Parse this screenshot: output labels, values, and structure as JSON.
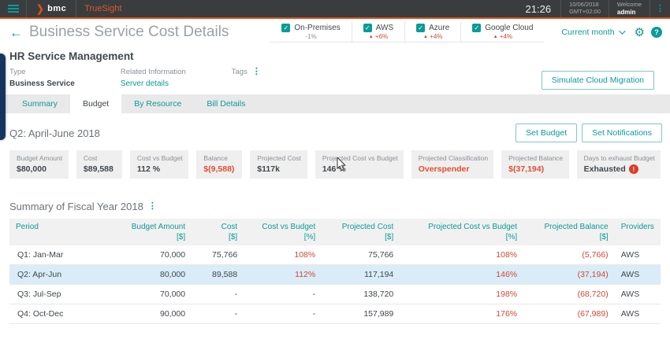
{
  "colors": {
    "accent_teal": "#0a9b98",
    "brand_orange": "#dd4f13",
    "negative_red": "#d14836",
    "row_highlight": "#d9ecf7"
  },
  "topbar": {
    "logo": "bmc",
    "product": "TrueSight",
    "time": "21:26",
    "date": "10/06/2018",
    "timezone": "GMT+02:00",
    "welcome_label": "Welcome",
    "user": "admin"
  },
  "header": {
    "title": "Business Service Cost Details",
    "providers": [
      {
        "label": "On-Premises",
        "delta": "-1%",
        "trend": "none"
      },
      {
        "label": "AWS",
        "delta": "+6%",
        "trend": "up"
      },
      {
        "label": "Azure",
        "delta": "+4%",
        "trend": "up"
      },
      {
        "label": "Google Cloud",
        "delta": "+4%",
        "trend": "up"
      }
    ],
    "period_selector": "Current month",
    "help_label": "?"
  },
  "service": {
    "name": "HR Service Management",
    "type_label": "Type",
    "type_value": "Business Service",
    "related_label": "Related Information",
    "related_link": "Server details",
    "tags_label": "Tags",
    "simulate_button": "Simulate Cloud Migration"
  },
  "tabs": [
    {
      "label": "Summary",
      "active": false
    },
    {
      "label": "Budget",
      "active": true
    },
    {
      "label": "By Resource",
      "active": false
    },
    {
      "label": "Bill Details",
      "active": false
    }
  ],
  "budget_section": {
    "quarter_title": "Q2: April-June 2018",
    "set_budget_button": "Set Budget",
    "set_notifications_button": "Set Notifications",
    "kpis": [
      {
        "label": "Budget Amount",
        "value": "$80,000",
        "tone": "normal"
      },
      {
        "label": "Cost",
        "value": "$89,588",
        "tone": "normal"
      },
      {
        "label": "Cost vs Budget",
        "value": "112 %",
        "tone": "normal"
      },
      {
        "label": "Balance",
        "value": "$(9,588)",
        "tone": "negative"
      },
      {
        "label": "Projected Cost",
        "value": "$117k",
        "tone": "normal"
      },
      {
        "label": "Projected Cost vs Budget",
        "value": "146 %",
        "tone": "normal"
      },
      {
        "label": "Projected Classification",
        "value": "Overspender",
        "tone": "negative"
      },
      {
        "label": "Projected Balance",
        "value": "$(37,194)",
        "tone": "negative"
      },
      {
        "label": "Days to exhaust Budget",
        "value": "Exhausted",
        "tone": "normal",
        "icon": "alert-icon"
      }
    ]
  },
  "fiscal_table": {
    "title": "Summary of Fiscal Year 2018",
    "columns": [
      {
        "label": "Period",
        "unit": "",
        "align": "lft",
        "width": "17%"
      },
      {
        "label": "Budget Amount",
        "unit": "[$]",
        "align": "num",
        "width": "11%"
      },
      {
        "label": "Cost",
        "unit": "[$]",
        "align": "num",
        "width": "8%"
      },
      {
        "label": "Cost vs Budget",
        "unit": "[%]",
        "align": "num",
        "width": "12%"
      },
      {
        "label": "Projected Cost",
        "unit": "[$]",
        "align": "num",
        "width": "12%"
      },
      {
        "label": "Projected Cost vs Budget",
        "unit": "[%]",
        "align": "num",
        "width": "19%"
      },
      {
        "label": "Projected Balance",
        "unit": "[$]",
        "align": "num",
        "width": "14%"
      },
      {
        "label": "Providers",
        "unit": "",
        "align": "lft",
        "width": "7%"
      }
    ],
    "rows": [
      {
        "cells": [
          "Q1: Jan-Mar",
          "70,000",
          "75,766",
          "108%",
          "75,766",
          "108%",
          "(5,766)",
          "AWS"
        ],
        "highlighted": false
      },
      {
        "cells": [
          "Q2: Apr-Jun",
          "80,000",
          "89,588",
          "112%",
          "117,194",
          "146%",
          "(37,194)",
          "AWS"
        ],
        "highlighted": true
      },
      {
        "cells": [
          "Q3: Jul-Sep",
          "70,000",
          "-",
          "-",
          "138,720",
          "198%",
          "(68,720)",
          "AWS"
        ],
        "highlighted": false
      },
      {
        "cells": [
          "Q4: Oct-Dec",
          "90,000",
          "-",
          "-",
          "157,989",
          "176%",
          "(67,989)",
          "AWS"
        ],
        "highlighted": false
      }
    ],
    "red_columns": [
      3,
      5,
      6
    ]
  }
}
